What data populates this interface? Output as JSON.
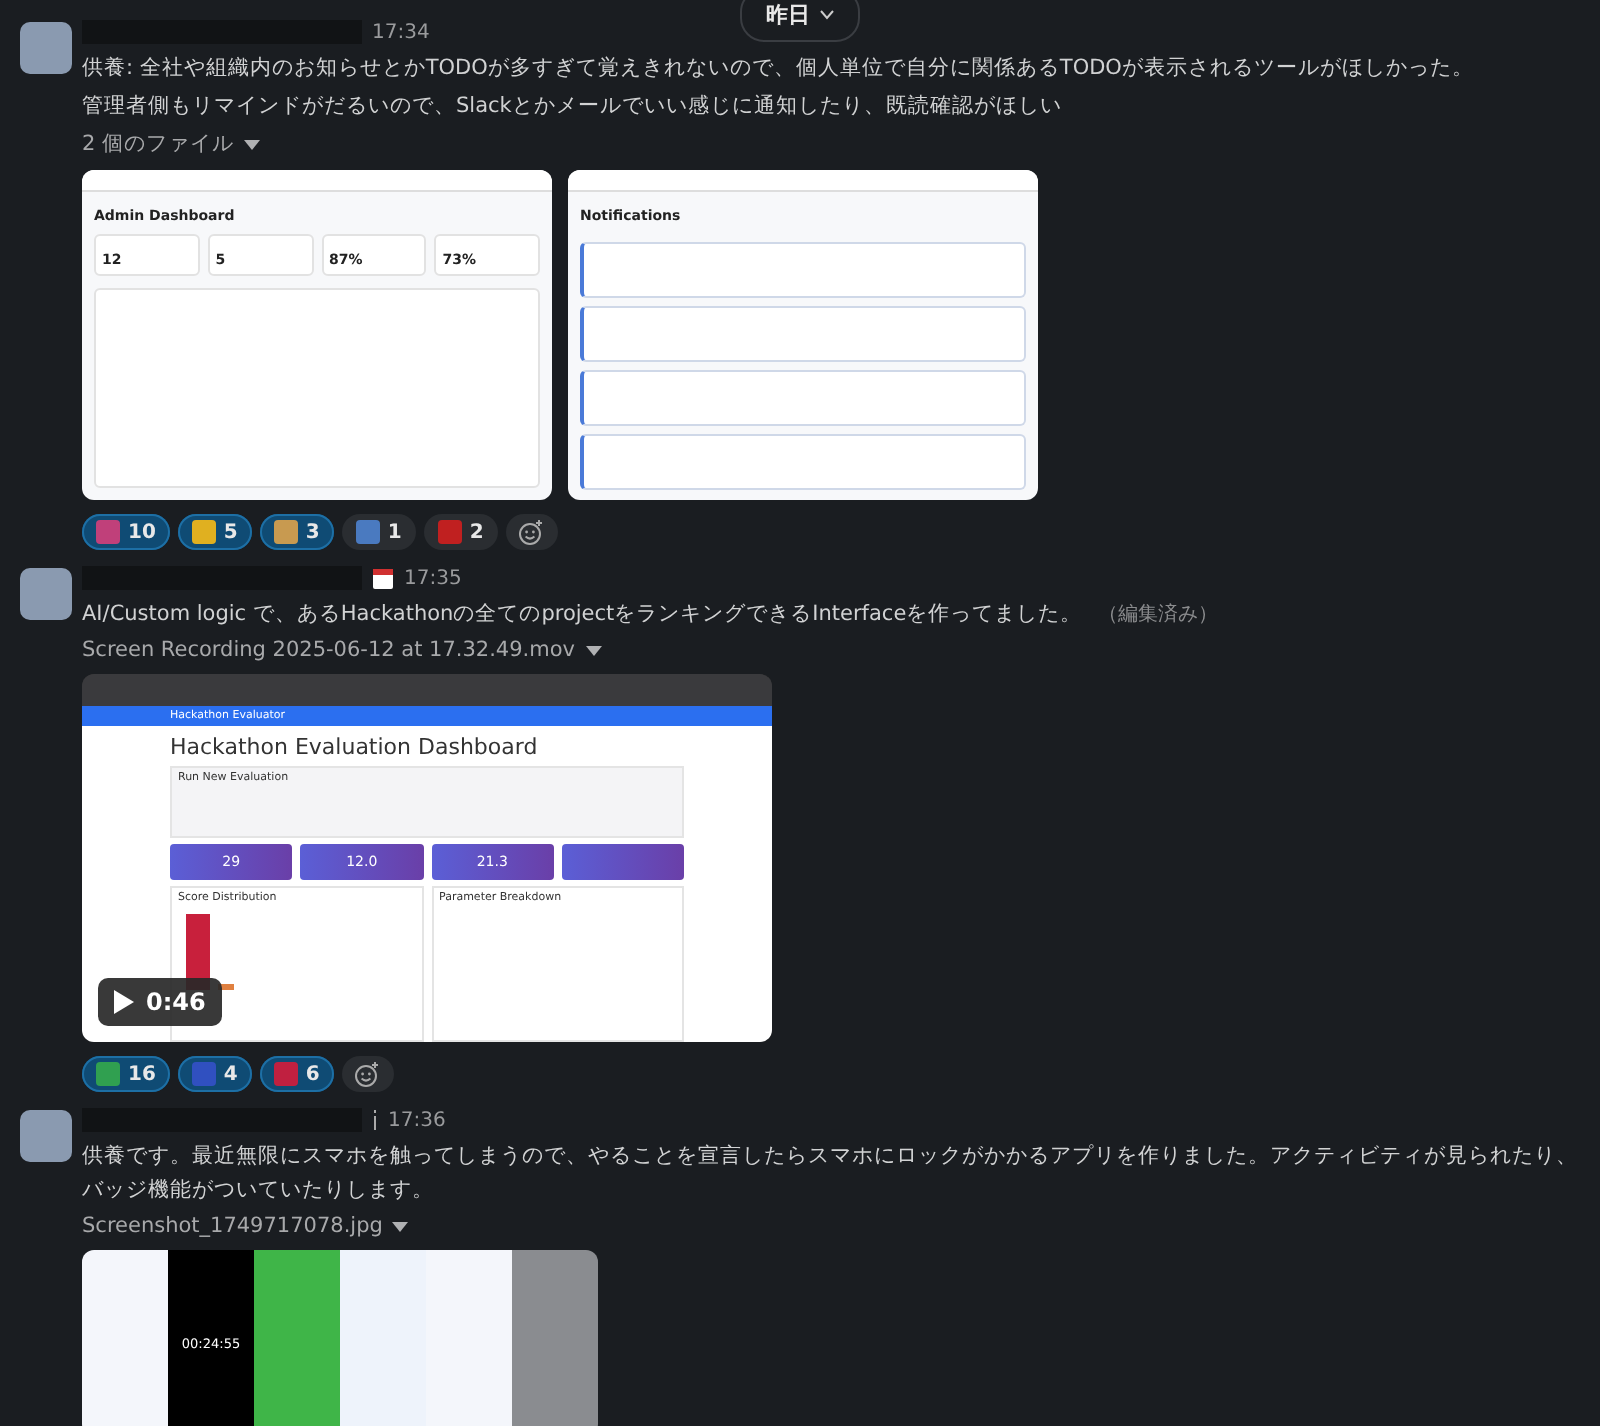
{
  "date_divider": {
    "label": "昨日"
  },
  "messages": [
    {
      "time": "17:34",
      "kind": "plain",
      "lines": [
        "供養: 全社や組織内のお知らせとかTODOが多すぎて覚えきれないので、個人単位で自分に関係あるTODOが表示されるツールがほしかった。",
        "管理者側もリマインドがだるいので、Slackとかメールでいい感じに通知したり、既読確認がほしい"
      ],
      "file_label": "2 個のファイル",
      "attachment": {
        "kind": "dashboards",
        "panels": [
          {
            "title": "Admin Dashboard",
            "stats": [
              "12",
              "5",
              "87%",
              "73%"
            ]
          },
          {
            "title": "Notifications"
          }
        ]
      },
      "reactions": [
        {
          "count": "10",
          "selected": true,
          "color": "#c0407a"
        },
        {
          "count": "5",
          "selected": true,
          "color": "#e0b020"
        },
        {
          "count": "3",
          "selected": true,
          "color": "#c89a50"
        },
        {
          "count": "1",
          "selected": false,
          "color": "#4a7ac0"
        },
        {
          "count": "2",
          "selected": false,
          "color": "#c02020"
        }
      ]
    },
    {
      "time": "17:35",
      "kind": "calendar",
      "lines": [
        "AI/Custom logic で、あるHackathonの全てのprojectをランキングできるInterfaceを作ってました。"
      ],
      "edited": "（編集済み）",
      "file_label": "Screen Recording 2025-06-12 at 17.32.49.mov",
      "attachment": {
        "kind": "video",
        "brand": "Hackathon Evaluator",
        "title": "Hackathon Evaluation Dashboard",
        "section": "Run New Evaluation",
        "stats": [
          "29",
          "12.0",
          "21.3"
        ],
        "chart_titles": [
          "Score Distribution",
          "Parameter Breakdown"
        ],
        "duration": "0:46"
      },
      "reactions": [
        {
          "count": "16",
          "selected": true,
          "color": "#30a050"
        },
        {
          "count": "4",
          "selected": true,
          "color": "#3050c0"
        },
        {
          "count": "6",
          "selected": true,
          "color": "#c02040"
        }
      ]
    },
    {
      "time": "17:36",
      "kind": "info",
      "lines": [
        "供養です。最近無限にスマホを触ってしまうので、やることを宣言したらスマホにロックがかかるアプリを作りました。アクティビティが見られたり、バッジ機能がついていたりします。"
      ],
      "file_label": "Screenshot_1749717078.jpg",
      "attachment": {
        "kind": "phones",
        "timer": "00:24:55"
      }
    }
  ]
}
